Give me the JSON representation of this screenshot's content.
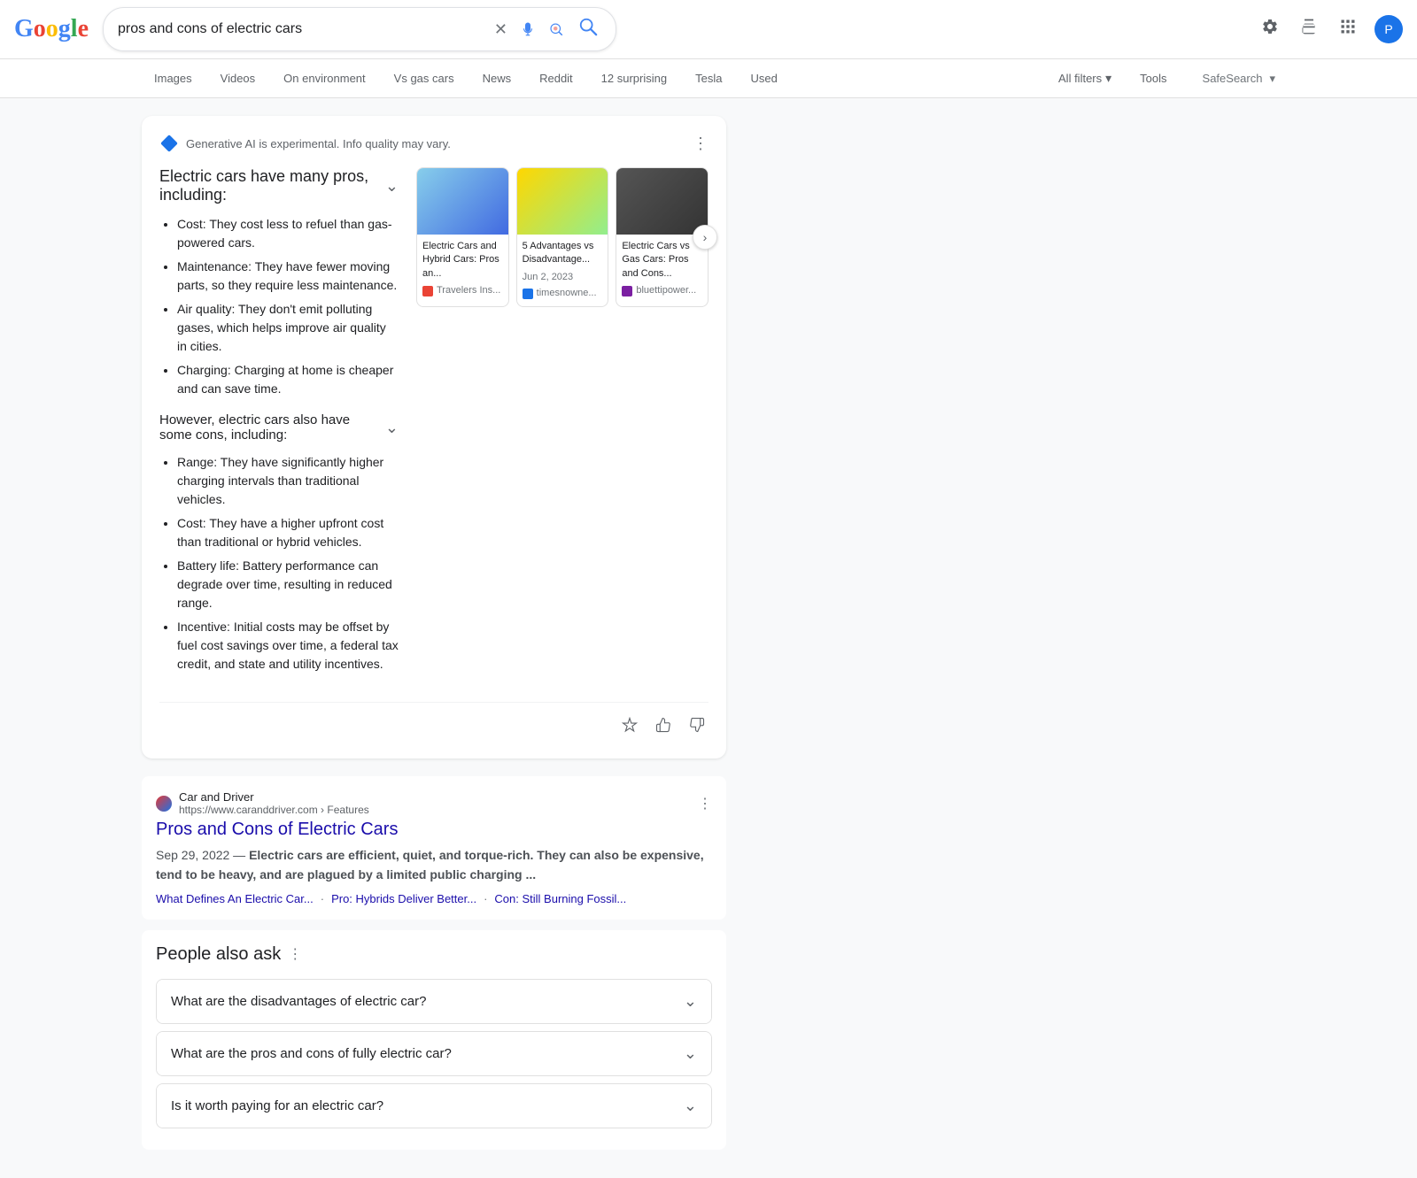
{
  "header": {
    "search_query": "pros and cons of electric cars",
    "avatar_initial": "P"
  },
  "nav": {
    "tabs": [
      {
        "label": "Images",
        "active": false
      },
      {
        "label": "Videos",
        "active": false
      },
      {
        "label": "On environment",
        "active": false
      },
      {
        "label": "Vs gas cars",
        "active": false
      },
      {
        "label": "News",
        "active": false
      },
      {
        "label": "Reddit",
        "active": false
      },
      {
        "label": "12 surprising",
        "active": false
      },
      {
        "label": "Tesla",
        "active": false
      },
      {
        "label": "Used",
        "active": false
      }
    ],
    "all_filters": "All filters",
    "tools": "Tools",
    "safesearch": "SafeSearch"
  },
  "ai_box": {
    "note": "Generative AI is experimental. Info quality may vary.",
    "pros_title": "Electric cars have many pros, including:",
    "pros": [
      "Cost: They cost less to refuel than gas-powered cars.",
      "Maintenance: They have fewer moving parts, so they require less maintenance.",
      "Air quality: They don't emit polluting gases, which helps improve air quality in cities.",
      "Charging: Charging at home is cheaper and can save time."
    ],
    "cons_title": "However, electric cars also have some cons, including:",
    "cons": [
      "Range: They have significantly higher charging intervals than traditional vehicles.",
      "Cost: They have a higher upfront cost than traditional or hybrid vehicles.",
      "Battery life: Battery performance can degrade over time, resulting in reduced range.",
      "Incentive: Initial costs may be offset by fuel cost savings over time, a federal tax credit, and state and utility incentives."
    ],
    "images": [
      {
        "title": "Electric Cars and Hybrid Cars: Pros an...",
        "source": "Travelers Ins...",
        "color": "blue"
      },
      {
        "title": "5 Advantages vs Disadvantage...",
        "date": "Jun 2, 2023",
        "source": "timesnowne...",
        "color": "yellow"
      },
      {
        "title": "Electric Cars vs Gas Cars: Pros and Cons...",
        "source": "bluettipower...",
        "color": "dark"
      }
    ]
  },
  "search_result": {
    "site_name": "Car and Driver",
    "url": "https://www.caranddriver.com › Features",
    "title": "Pros and Cons of Electric Cars",
    "snippet_date": "Sep 29, 2022",
    "snippet": "Electric cars are efficient, quiet, and torque-rich. They can also be expensive, tend to be heavy, and are plagued by a limited public charging ...",
    "links": [
      "What Defines An Electric Car...",
      "Pro: Hybrids Deliver Better...",
      "Con: Still Burning Fossil..."
    ]
  },
  "paa": {
    "title": "People also ask",
    "questions": [
      "What are the disadvantages of electric car?",
      "What are the pros and cons of fully electric car?",
      "Is it worth paying for an electric car?"
    ]
  },
  "icons": {
    "clear": "✕",
    "mic": "🎤",
    "lens": "🔍",
    "search": "🔍",
    "settings": "⚙",
    "labs": "🧪",
    "apps": "⋮⋮",
    "chevron_down": "▾",
    "chevron_right": "›",
    "more_vert": "⋮",
    "thumbs_up": "👍",
    "thumbs_down": "👎",
    "note_icon": "📝",
    "expand": "⌄"
  }
}
